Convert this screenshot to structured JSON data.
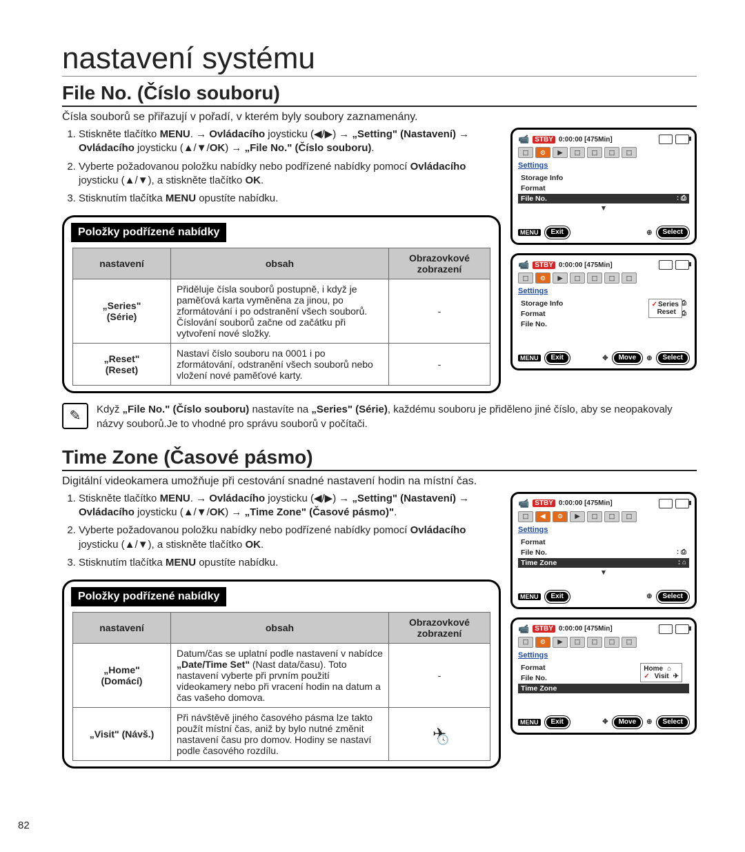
{
  "page_title": "nastavení systému",
  "page_number": "82",
  "file_no": {
    "title": "File No. (Číslo souboru)",
    "intro": "Čísla souborů se přiřazují v pořadí, v kterém byly soubory zaznamenány.",
    "steps": [
      {
        "pre": "Stiskněte tlačítko ",
        "b1": "MENU",
        "mid1": ". → ",
        "b2": "Ovládacího",
        "mid2": " joysticku (◀/▶) → ",
        "b3": "„Setting\" (Nastavení)",
        "mid3": " → ",
        "b4": "Ovládacího",
        "mid4": " joysticku (▲/▼/",
        "b5": "OK",
        "mid5": ") → ",
        "b6": "„File No.\" (Číslo souboru)",
        "end": "."
      },
      {
        "pre": "Vyberte požadovanou položku nabídky nebo podřízené nabídky pomocí ",
        "b1": "Ovládacího",
        "mid1": " joysticku (▲/▼), a stiskněte tlačítko ",
        "b2": "OK",
        "end": "."
      },
      {
        "pre": "Stisknutím tlačítka ",
        "b1": "MENU",
        "end": " opustíte nabídku."
      }
    ],
    "submenu_label": "Položky podřízené nabídky",
    "headers": {
      "c1": "nastavení",
      "c2": "obsah",
      "c3": "Obrazovkové zobrazení"
    },
    "rows": [
      {
        "name": "„Series\"",
        "sub": "(Série)",
        "desc": "Přiděluje čísla souborů postupně, i když je paměťová karta vyměněna za jinou, po zformátování i po odstranění všech souborů. Číslování souborů začne od začátku při vytvoření nové složky.",
        "disp": "-"
      },
      {
        "name": "„Reset\"",
        "sub": "(Reset)",
        "desc": "Nastaví číslo souboru na 0001 i po zformátování, odstranění všech souborů nebo vložení nové paměťové karty.",
        "disp": "-"
      }
    ],
    "note": {
      "pre": "Když ",
      "b1": "„File No.\" (Číslo souboru)",
      "mid1": " nastavíte na ",
      "b2": "„Series\" (Série)",
      "end": ", každému souboru je přiděleno jiné číslo, aby se neopakovaly názvy souborů.Je to vhodné pro správu souborů v počítači."
    },
    "screens": {
      "a": {
        "stby": "STBY",
        "time": "0:00:00 [475Min]",
        "settings": "Settings",
        "items": [
          "Storage Info",
          "Format",
          "File No."
        ],
        "sel": "File No.",
        "exit": "Exit",
        "select": "Select",
        "menu": "MENU"
      },
      "b": {
        "stby": "STBY",
        "time": "0:00:00 [475Min]",
        "settings": "Settings",
        "items": [
          "Storage Info",
          "Format",
          "File No."
        ],
        "popup": {
          "opt1": "Series",
          "opt2": "Reset",
          "chk": "✓"
        },
        "exit": "Exit",
        "move": "Move",
        "select": "Select",
        "menu": "MENU"
      }
    }
  },
  "time_zone": {
    "title": "Time Zone (Časové pásmo)",
    "intro": "Digitální videokamera umožňuje při cestování snadné nastavení hodin na místní čas.",
    "steps": [
      {
        "pre": "Stiskněte tlačítko ",
        "b1": "MENU",
        "mid1": ". → ",
        "b2": "Ovládacího",
        "mid2": " joysticku (◀/▶) → ",
        "b3": "„Setting\" (Nastavení)",
        "mid3": " → ",
        "b4": "Ovládacího",
        "mid4": " joysticku (▲/▼/",
        "b5": "OK",
        "mid5": ") → ",
        "b6": "„Time Zone\" (Časové pásmo)\"",
        "end": "."
      },
      {
        "pre": "Vyberte požadovanou položku nabídky nebo podřízené nabídky pomocí ",
        "b1": "Ovládacího",
        "mid1": " joysticku (▲/▼), a stiskněte tlačítko ",
        "b2": "OK",
        "end": "."
      },
      {
        "pre": "Stisknutím tlačítka ",
        "b1": "MENU",
        "end": " opustíte nabídku."
      }
    ],
    "submenu_label": "Položky podřízené nabídky",
    "headers": {
      "c1": "nastavení",
      "c2": "obsah",
      "c3": "Obrazovkové zobrazení"
    },
    "rows": [
      {
        "name": "„Home\"",
        "sub": "(Domácí)",
        "desc": "Datum/čas se uplatní podle nastavení v nabídce „Date/Time Set\" (Nast data/času). Toto nastavení vyberte při prvním použití videokamery nebo při vracení hodin na datum a čas vašeho domova.",
        "disp": "-",
        "b1": "„Date/Time Set\""
      },
      {
        "name": "„Visit\" (Návš.)",
        "sub": "",
        "desc": "Při návštěvě jiného časového pásma lze takto použít místní čas, aniž by bylo nutné změnit nastavení času pro domov. Hodiny se nastaví podle časového rozdílu.",
        "disp": "icon"
      }
    ],
    "screens": {
      "a": {
        "stby": "STBY",
        "time": "0:00:00 [475Min]",
        "settings": "Settings",
        "items": [
          "Format",
          "File No.",
          "Time Zone"
        ],
        "sel": "Time Zone",
        "exit": "Exit",
        "select": "Select",
        "menu": "MENU"
      },
      "b": {
        "stby": "STBY",
        "time": "0:00:00 [475Min]",
        "settings": "Settings",
        "items": [
          "Format",
          "File No.",
          "Time Zone"
        ],
        "sel": "Time Zone",
        "popup": {
          "opt1": "Home",
          "opt2": "Visit",
          "chk": "✓"
        },
        "exit": "Exit",
        "move": "Move",
        "select": "Select",
        "menu": "MENU"
      }
    }
  }
}
